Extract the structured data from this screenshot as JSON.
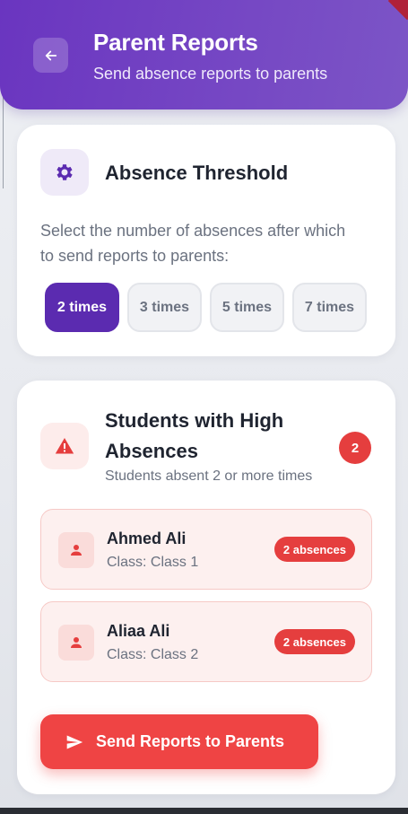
{
  "header": {
    "title": "Parent Reports",
    "subtitle": "Send absence reports to parents"
  },
  "threshold": {
    "title": "Absence Threshold",
    "description": "Select the number of absences after which to send reports to parents:",
    "options": [
      "2 times",
      "3 times",
      "5 times",
      "7 times"
    ],
    "selected": "2 times"
  },
  "students_section": {
    "title": "Students with High Absences",
    "subtitle": "Students absent 2 or more times",
    "count": "2",
    "students": [
      {
        "name": "Ahmed Ali",
        "class": "Class: Class 1",
        "absences": "2 absences"
      },
      {
        "name": "Aliaa Ali",
        "class": "Class: Class 2",
        "absences": "2 absences"
      }
    ]
  },
  "actions": {
    "send_label": "Send Reports to Parents"
  },
  "colors": {
    "primary": "#6a35c0",
    "danger": "#ef4444",
    "selected_chip": "#5b2bb0"
  }
}
